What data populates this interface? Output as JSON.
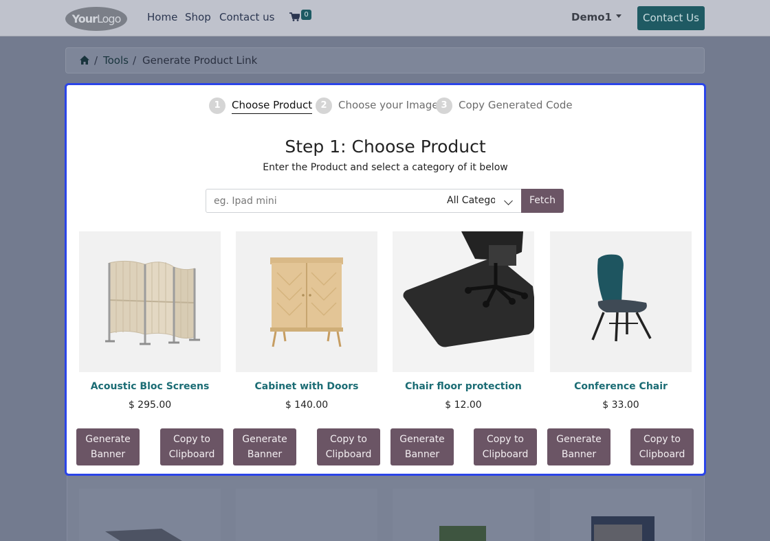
{
  "navbar": {
    "logo": {
      "part1": "Your",
      "part2": "Logo"
    },
    "links": [
      "Home",
      "Shop",
      "Contact us"
    ],
    "cart_count": "0",
    "user": "Demo1",
    "contact_button": "Contact Us"
  },
  "breadcrumb": {
    "separator": "/",
    "items": [
      "Tools",
      "Generate Product Link"
    ]
  },
  "wizard": {
    "steps": [
      {
        "num": "1",
        "label": "Choose Product"
      },
      {
        "num": "2",
        "label": "Choose your Image"
      },
      {
        "num": "3",
        "label": "Copy Generated Code"
      }
    ],
    "title": "Step 1: Choose Product",
    "subtitle": "Enter the Product and select a category of it below",
    "search_placeholder": "eg. Ipad mini",
    "category_selected": "All Categories",
    "fetch_button": "Fetch",
    "generate_label_1": "Generate",
    "generate_label_2": "Banner",
    "copy_label_1": "Copy to",
    "copy_label_2": "Clipboard"
  },
  "products": [
    {
      "name": "Acoustic Bloc Screens",
      "price": "$ 295.00",
      "image": "acoustic-screens"
    },
    {
      "name": "Cabinet with Doors",
      "price": "$ 140.00",
      "image": "wooden-cabinet"
    },
    {
      "name": "Chair floor protection",
      "price": "$ 12.00",
      "image": "floor-mat"
    },
    {
      "name": "Conference Chair",
      "price": "$ 33.00",
      "image": "teal-chair"
    }
  ],
  "colors": {
    "accent_teal": "#1b6c74",
    "button_mauve": "#6b5565",
    "modal_border": "#2a44e8"
  }
}
